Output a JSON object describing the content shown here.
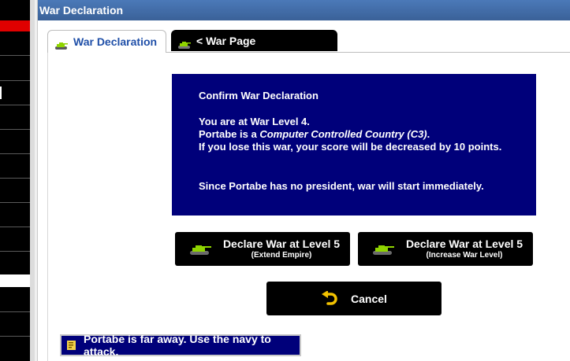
{
  "window": {
    "title": "War Declaration"
  },
  "tabs": [
    {
      "label": "War Declaration",
      "active": true,
      "icon": "tank-icon"
    },
    {
      "label": "< War Page",
      "active": false,
      "icon": "tank-icon"
    }
  ],
  "confirm": {
    "heading": "Confirm War Declaration",
    "line1": "You are at War Level 4.",
    "line2_prefix": "Portabe is a ",
    "line2_italic": "Computer Controlled Country (C3)",
    "line2_suffix": ".",
    "line3": "If you lose this war, your score will be decreased by 10 points.",
    "line4": "Since Portabe has no president, war will start immediately."
  },
  "buttons": {
    "declare_extend": {
      "label": "Declare War at Level 5",
      "sublabel": "(Extend Empire)"
    },
    "declare_increase": {
      "label": "Declare War at Level 5",
      "sublabel": "(Increase War Level)"
    },
    "cancel": {
      "label": "Cancel"
    }
  },
  "notice": {
    "text": "Portabe is far away. Use the navy to attack.",
    "icon": "scroll-icon"
  },
  "colors": {
    "titlebar": "#4169a6",
    "confirm_bg": "#00007a",
    "tank_green": "#8fd400",
    "undo_yellow": "#f2c200"
  }
}
